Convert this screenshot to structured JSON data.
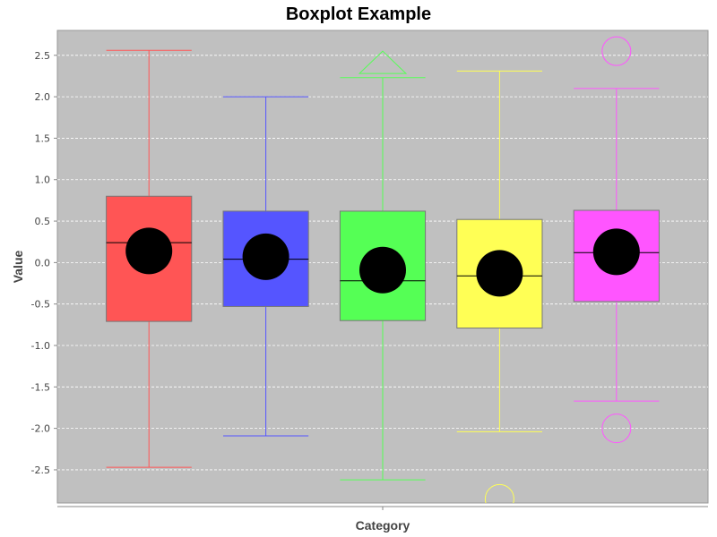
{
  "chart_data": {
    "type": "boxplot",
    "title": "Boxplot Example",
    "xlabel": "Category",
    "ylabel": "Value",
    "ylim": [
      -2.9,
      2.8
    ],
    "yticks": [
      -2.5,
      -2.0,
      -1.5,
      -1.0,
      -0.5,
      0.0,
      0.5,
      1.0,
      1.5,
      2.0,
      2.5
    ],
    "ytick_labels": [
      "-2.5",
      "-2.0",
      "-1.5",
      "-1.0",
      "-0.5",
      "0.0",
      "0.5",
      "1.0",
      "1.5",
      "2.0",
      "2.5"
    ],
    "grid": true,
    "legend": "none",
    "plot_background": "#c0c0c0",
    "series": [
      {
        "color": "#ff5555",
        "whisker_low": -2.47,
        "q1": -0.71,
        "median": 0.24,
        "q3": 0.8,
        "whisker_high": 2.56,
        "mean": 0.14,
        "outliers": [],
        "far_outliers_high": [],
        "far_outliers_low": []
      },
      {
        "color": "#5555ff",
        "whisker_low": -2.09,
        "q1": -0.53,
        "median": 0.04,
        "q3": 0.62,
        "whisker_high": 2.0,
        "mean": 0.07,
        "outliers": [],
        "far_outliers_high": [],
        "far_outliers_low": []
      },
      {
        "color": "#55ff55",
        "whisker_low": -2.62,
        "q1": -0.7,
        "median": -0.22,
        "q3": 0.62,
        "whisker_high": 2.23,
        "mean": -0.09,
        "outliers": [],
        "far_outliers_high": [
          2.55
        ],
        "far_outliers_low": []
      },
      {
        "color": "#ffff55",
        "whisker_low": -2.04,
        "q1": -0.79,
        "median": -0.16,
        "q3": 0.52,
        "whisker_high": 2.31,
        "mean": -0.13,
        "outliers": [
          -2.85
        ],
        "far_outliers_high": [],
        "far_outliers_low": []
      },
      {
        "color": "#ff55ff",
        "whisker_low": -1.67,
        "q1": -0.47,
        "median": 0.12,
        "q3": 0.63,
        "whisker_high": 2.1,
        "mean": 0.13,
        "outliers": [
          2.55,
          -2.0
        ],
        "far_outliers_high": [],
        "far_outliers_low": []
      }
    ]
  }
}
